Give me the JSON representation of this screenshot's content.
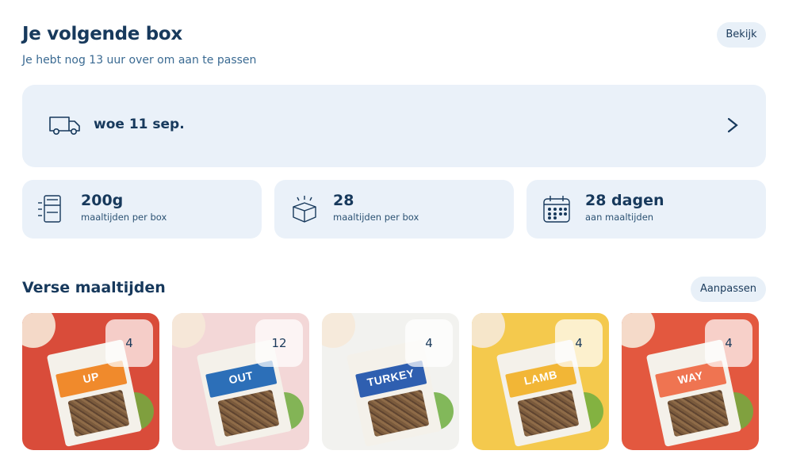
{
  "header": {
    "title": "Je volgende box",
    "subtitle": "Je hebt nog 13 uur over om aan te passen",
    "view_label": "Bekijk"
  },
  "delivery": {
    "date": "woe 11 sep.",
    "icon": "truck-icon",
    "chevron": ">"
  },
  "stats": [
    {
      "value": "200g",
      "label": "maaltijden per box",
      "icon": "fridge-icon"
    },
    {
      "value": "28",
      "label": "maaltijden per box",
      "icon": "box-icon"
    },
    {
      "value": "28 dagen",
      "label": "aan maaltijden",
      "icon": "calendar-icon"
    }
  ],
  "meals_section": {
    "title": "Verse maaltijden",
    "adjust_label": "Aanpassen",
    "items": [
      {
        "name": "BEEF IT UP",
        "quantity": "4",
        "bg": "#d94c3a",
        "pack": "#f08a2c"
      },
      {
        "name": "CHICKEN YOU OUT",
        "quantity": "12",
        "bg": "#f3d7d7",
        "pack": "#2c6fb8"
      },
      {
        "name": "GOBBLE GOBBLE TURKEY",
        "quantity": "4",
        "bg": "#f2f2ef",
        "pack": "#2f5fb0"
      },
      {
        "name": "WHAM BAM LAMB",
        "quantity": "4",
        "bg": "#f4c94d",
        "pack": "#f2b636"
      },
      {
        "name": "PORK THIS WAY",
        "quantity": "4",
        "bg": "#e3583f",
        "pack": "#ef7451"
      }
    ]
  },
  "colors": {
    "brand_dark": "#17395c",
    "panel_bg": "#eaf1f9",
    "pill_bg": "#e8f0f8"
  }
}
